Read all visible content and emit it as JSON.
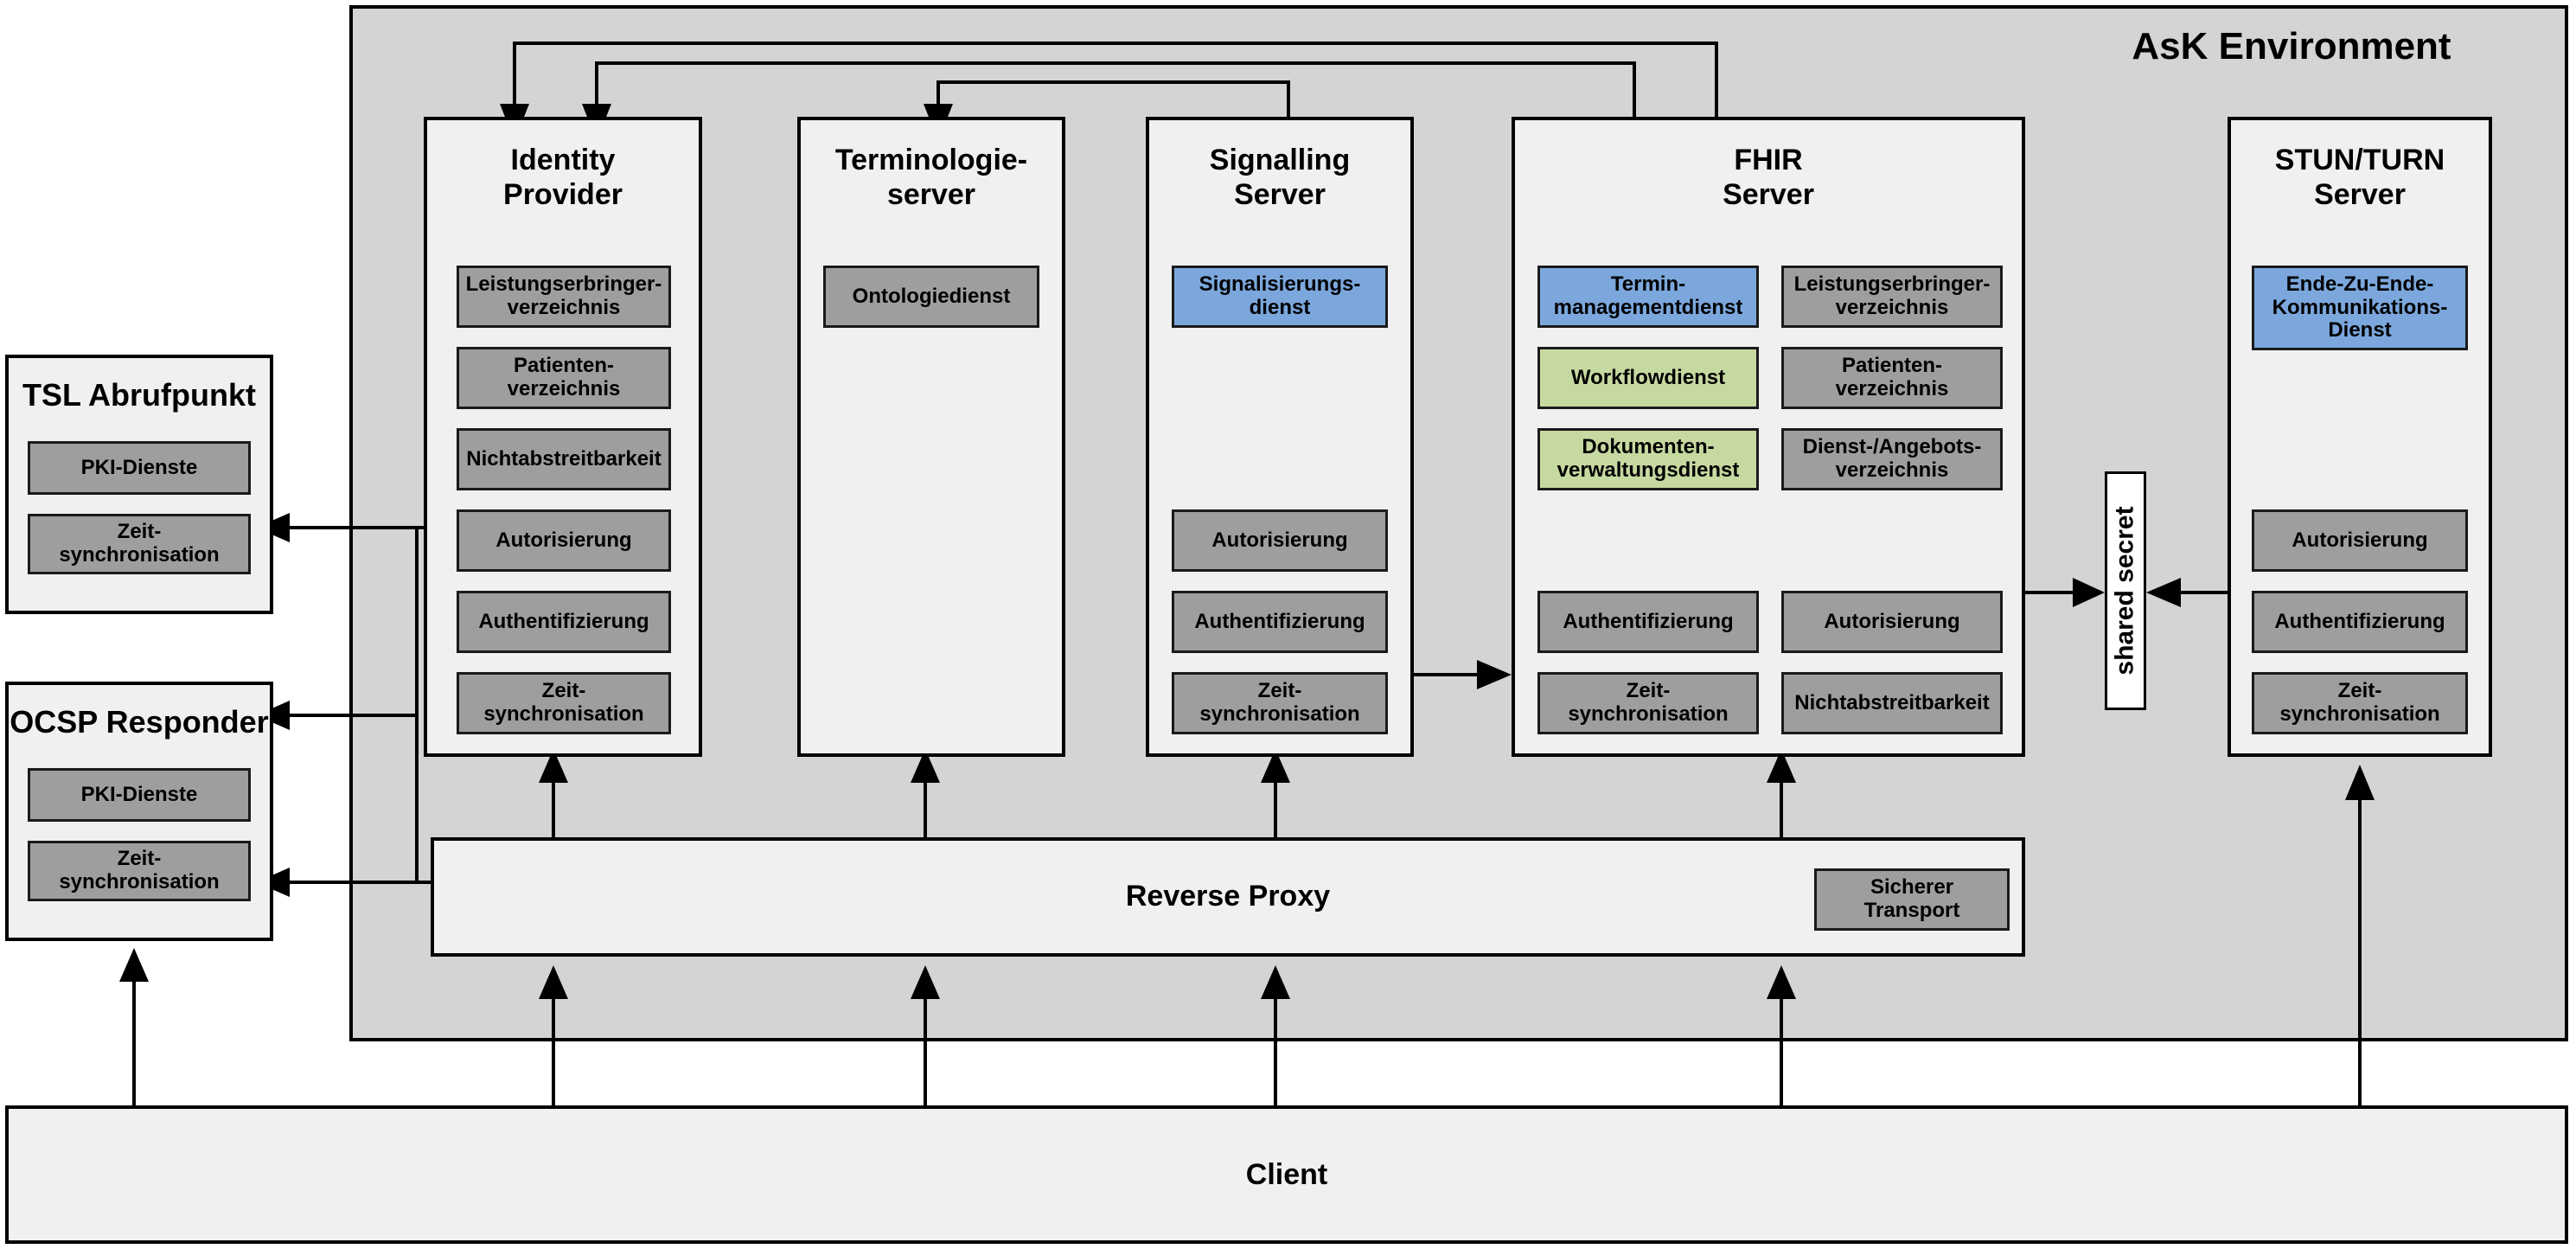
{
  "environment": {
    "title": "AsK Environment"
  },
  "left_column": {
    "tsl": {
      "title": "TSL Abrufpunkt",
      "services": [
        {
          "label": "PKI-Dienste",
          "color": "gray"
        },
        {
          "label": "Zeit-\nsynchronisation",
          "color": "gray"
        }
      ]
    },
    "ocsp": {
      "title": "OCSP Responder",
      "services": [
        {
          "label": "PKI-Dienste",
          "color": "gray"
        },
        {
          "label": "Zeit-\nsynchronisation",
          "color": "gray"
        }
      ]
    }
  },
  "servers": [
    {
      "id": "identity-provider",
      "title": "Identity\nProvider",
      "services": [
        {
          "label": "Leistungserbringer-\nverzeichnis",
          "color": "gray"
        },
        {
          "label": "Patienten-\nverzeichnis",
          "color": "gray"
        },
        {
          "label": "Nichtabstreitbarkeit",
          "color": "gray"
        },
        {
          "label": "Autorisierung",
          "color": "gray"
        },
        {
          "label": "Authentifizierung",
          "color": "gray"
        },
        {
          "label": "Zeit-\nsynchronisation",
          "color": "gray"
        }
      ]
    },
    {
      "id": "terminologieserver",
      "title": "Terminologie-\nserver",
      "services": [
        {
          "label": "Ontologiedienst",
          "color": "gray"
        }
      ]
    },
    {
      "id": "signalling-server",
      "title": "Signalling\nServer",
      "services": [
        {
          "label": "Signalisierungs-\ndienst",
          "color": "blue"
        },
        {
          "label": "Autorisierung",
          "color": "gray"
        },
        {
          "label": "Authentifizierung",
          "color": "gray"
        },
        {
          "label": "Zeit-\nsynchronisation",
          "color": "gray"
        }
      ]
    },
    {
      "id": "fhir-server",
      "title": "FHIR\nServer",
      "services_left": [
        {
          "label": "Termin-\nmanagementdienst",
          "color": "blue"
        },
        {
          "label": "Workflowdienst",
          "color": "green"
        },
        {
          "label": "Dokumenten-\nverwaltungsdienst",
          "color": "green"
        },
        {
          "label": "Authentifizierung",
          "color": "gray"
        },
        {
          "label": "Zeit-\nsynchronisation",
          "color": "gray"
        }
      ],
      "services_right": [
        {
          "label": "Leistungserbringer-\nverzeichnis",
          "color": "gray"
        },
        {
          "label": "Patienten-\nverzeichnis",
          "color": "gray"
        },
        {
          "label": "Dienst-/Angebots-\nverzeichnis",
          "color": "gray"
        },
        {
          "label": "Autorisierung",
          "color": "gray"
        },
        {
          "label": "Nichtabstreitbarkeit",
          "color": "gray"
        }
      ]
    },
    {
      "id": "stun-turn-server",
      "title": "STUN/TURN\nServer",
      "services": [
        {
          "label": "Ende-Zu-Ende-\nKommunikations-\nDienst",
          "color": "blue"
        },
        {
          "label": "Autorisierung",
          "color": "gray"
        },
        {
          "label": "Authentifizierung",
          "color": "gray"
        },
        {
          "label": "Zeit-\nsynchronisation",
          "color": "gray"
        }
      ]
    }
  ],
  "shared_secret": {
    "label": "shared secret"
  },
  "reverse_proxy": {
    "title": "Reverse Proxy",
    "services": [
      {
        "label": "Sicherer Transport",
        "color": "gray"
      }
    ]
  },
  "client": {
    "title": "Client"
  },
  "colors": {
    "environment_bg": "#d4d4d4",
    "server_bg": "#f0f0f0",
    "service_gray": "#9e9e9e",
    "service_blue": "#7ba7dd",
    "service_green": "#c6d9a0",
    "stroke": "#000000"
  }
}
